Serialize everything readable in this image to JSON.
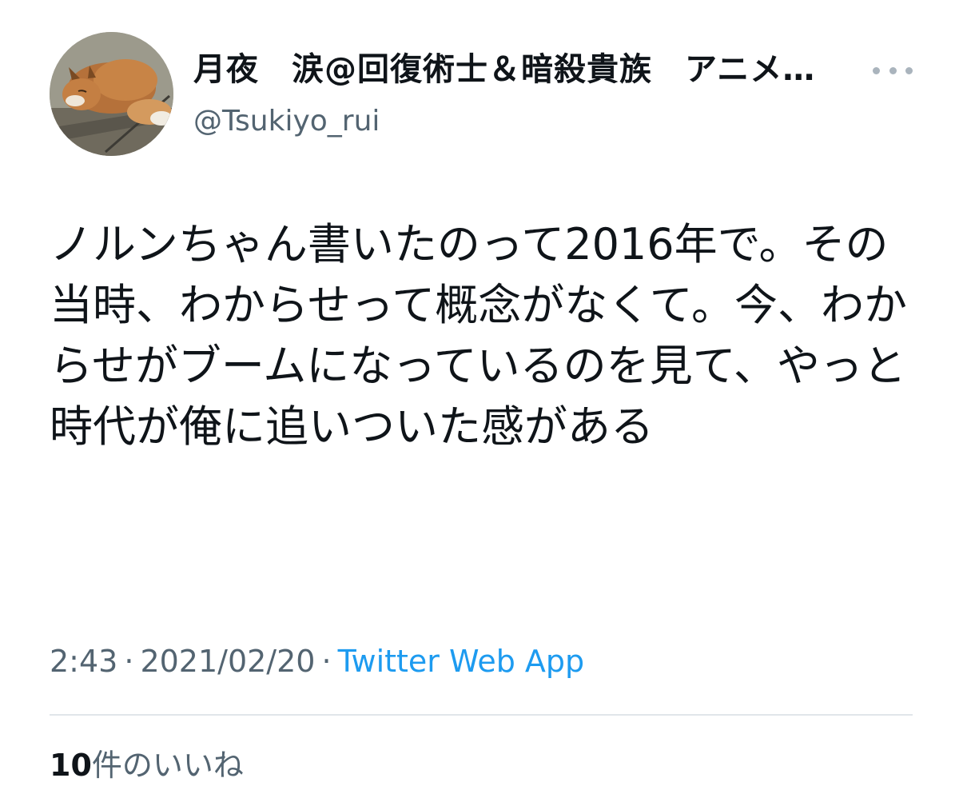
{
  "tweet": {
    "author": {
      "display_name": "月夜　涙@回復術士＆暗殺貴族　アニメ…",
      "handle": "@Tsukiyo_rui",
      "avatar_icon": "fox-avatar-icon"
    },
    "more_icon": "more-horizontal-icon",
    "text": "ノルンちゃん書いたのって2016年で。その当時、わからせって概念がなくて。今、わからせがブームになっているのを見て、やっと時代が俺に追いついた感がある",
    "time": "2:43",
    "separator": "·",
    "date": "2021/02/20",
    "source": "Twitter Web App",
    "likes_count": "10",
    "likes_label": "件のいいね"
  },
  "colors": {
    "text_primary": "#0f1419",
    "text_secondary": "#536471",
    "link": "#1d9bf0",
    "divider": "#e1e6ea"
  }
}
